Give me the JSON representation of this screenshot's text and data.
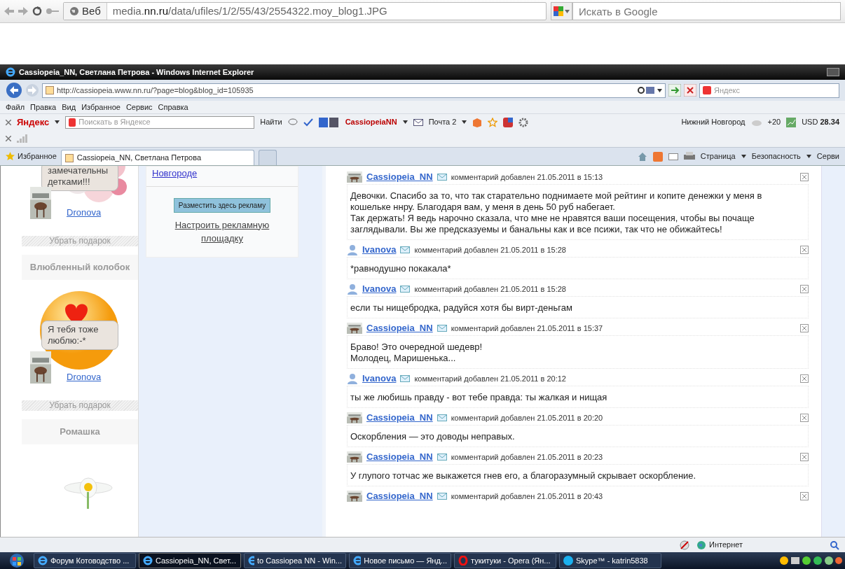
{
  "outer_browser": {
    "search_type": "Веб",
    "url_host_before": "media.",
    "url_host": "nn.ru",
    "url_path": "/data/ufiles/1/2/55/43/2554322.moy_blog1.JPG",
    "search_placeholder": "Искать в Google"
  },
  "ie_window": {
    "title": "Cassiopeia_NN, Светлана Петрова - Windows Internet Explorer",
    "address": "http://cassiopeia.www.nn.ru/?page=blog&blog_id=105935",
    "search_placeholder": "Яндекс",
    "menu": [
      "Файл",
      "Правка",
      "Вид",
      "Избранное",
      "Сервис",
      "Справка"
    ],
    "yandex_toolbar": {
      "logo": "Яндекс",
      "search_placeholder": "Поискать в Яндексе",
      "find": "Найти",
      "user": "CassiopeiaNN",
      "mail": "Почта 2",
      "city": "Нижний Новгород",
      "weather": "+20",
      "currency": "USD",
      "rate": "28.34"
    },
    "favorites": "Избранное",
    "tabs": [
      {
        "label": "Cassiopeia_NN, Светлана Петрова",
        "selected": true
      }
    ],
    "command_bar": [
      "Страница",
      "Безопасность",
      "Серви"
    ]
  },
  "gifts": [
    {
      "kind": "flowers",
      "bubble": "замечательны\nдетками!!!",
      "user": "Dronova",
      "remove": "Убрать подарок"
    },
    {
      "kind": "smiley",
      "title": "Влюбленный колобок",
      "bubble": "Я тебя тоже\nлюблю:-*",
      "user": "Dronova",
      "remove": "Убрать подарок"
    },
    {
      "kind": "daisy",
      "title": "Ромашка"
    }
  ],
  "ad": {
    "link_tail": "Новгороде",
    "button": "Разместить здесь рекламу",
    "settings_link": "Настроить рекламную площадку"
  },
  "comments": [
    {
      "author": "Cassiopeia_NN",
      "meta": "комментарий добавлен 21.05.2011 в 15:13",
      "text": "Девочки. Спасибо за то, что так старательно поднимаете мой рейтинг и копите денежки у меня в кошельке ннру. Благодаря вам, у меня в день 50 руб набегает.\nТак держать! Я ведь нарочно сказала, что мне не нравятся ваши посещения, чтобы вы почаще заглядывали. Вы же предсказуемы и банальны как и все псижи, так что не обижайтесь!"
    },
    {
      "kind": "default",
      "author": "Ivanova",
      "meta": "комментарий добавлен 21.05.2011 в 15:28",
      "text": "*равнодушно покакала*"
    },
    {
      "kind": "default",
      "author": "Ivanova",
      "meta": "комментарий добавлен 21.05.2011 в 15:28",
      "text": "если ты нищебродка, радуйся хотя бы вирт-деньгам"
    },
    {
      "author": "Cassiopeia_NN",
      "meta": "комментарий добавлен 21.05.2011 в 15:37",
      "text": "Браво! Это очередной шедевр!\nМолодец, Маришенька..."
    },
    {
      "kind": "default",
      "author": "Ivanova",
      "meta": "комментарий добавлен 21.05.2011 в 20:12",
      "text": "ты же любишь правду - вот тебе правда: ты жалкая и нищая"
    },
    {
      "author": "Cassiopeia_NN",
      "meta": "комментарий добавлен 21.05.2011 в 20:20",
      "text": "Оскорбления — это доводы неправых."
    },
    {
      "author": "Cassiopeia_NN",
      "meta": "комментарий добавлен 21.05.2011 в 20:23",
      "text": "У глупого тотчас же выкажется гнев его, а благоразумный скрывает оскорбление."
    },
    {
      "author": "Cassiopeia_NN",
      "meta": "комментарий добавлен 21.05.2011 в 20:43"
    }
  ],
  "status_bar": {
    "zone": "Интернет"
  },
  "taskbar": [
    {
      "kind": "ie",
      "label": "Форум Котоводство ...",
      "selected": false
    },
    {
      "kind": "ie",
      "label": "Cassiopeia_NN, Свет...",
      "selected": true
    },
    {
      "kind": "ie",
      "label": "to Cassiopea NN - Win...",
      "selected": false
    },
    {
      "kind": "ie",
      "label": "Новое письмо — Янд...",
      "selected": false
    },
    {
      "kind": "opera",
      "label": "тукитуки - Opera (Ян...",
      "selected": false
    },
    {
      "kind": "skype",
      "label": "Skype™ - katrin5838",
      "selected": false
    }
  ]
}
